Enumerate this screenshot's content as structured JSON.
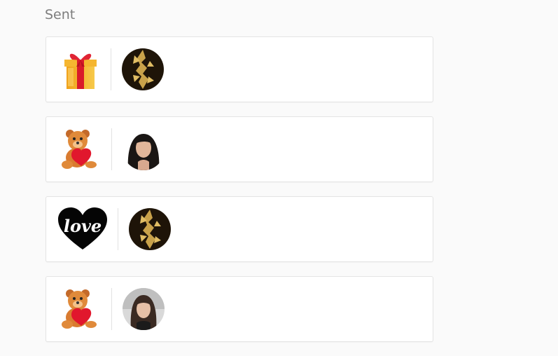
{
  "section": {
    "title": "Sent"
  },
  "gifts": [
    {
      "gift_icon": "gift-box-icon",
      "recipient_avatar": "gold-foliage-avatar"
    },
    {
      "gift_icon": "teddy-bear-heart-icon",
      "recipient_avatar": "woman-dark-hair-avatar"
    },
    {
      "gift_icon": "love-heart-icon",
      "gift_text": "love",
      "recipient_avatar": "gold-foliage-avatar"
    },
    {
      "gift_icon": "teddy-bear-heart-icon",
      "recipient_avatar": "woman-long-hair-avatar"
    }
  ],
  "colors": {
    "card_border": "#e4e4e4",
    "background": "#fafafa",
    "title": "#7d7d7d"
  }
}
